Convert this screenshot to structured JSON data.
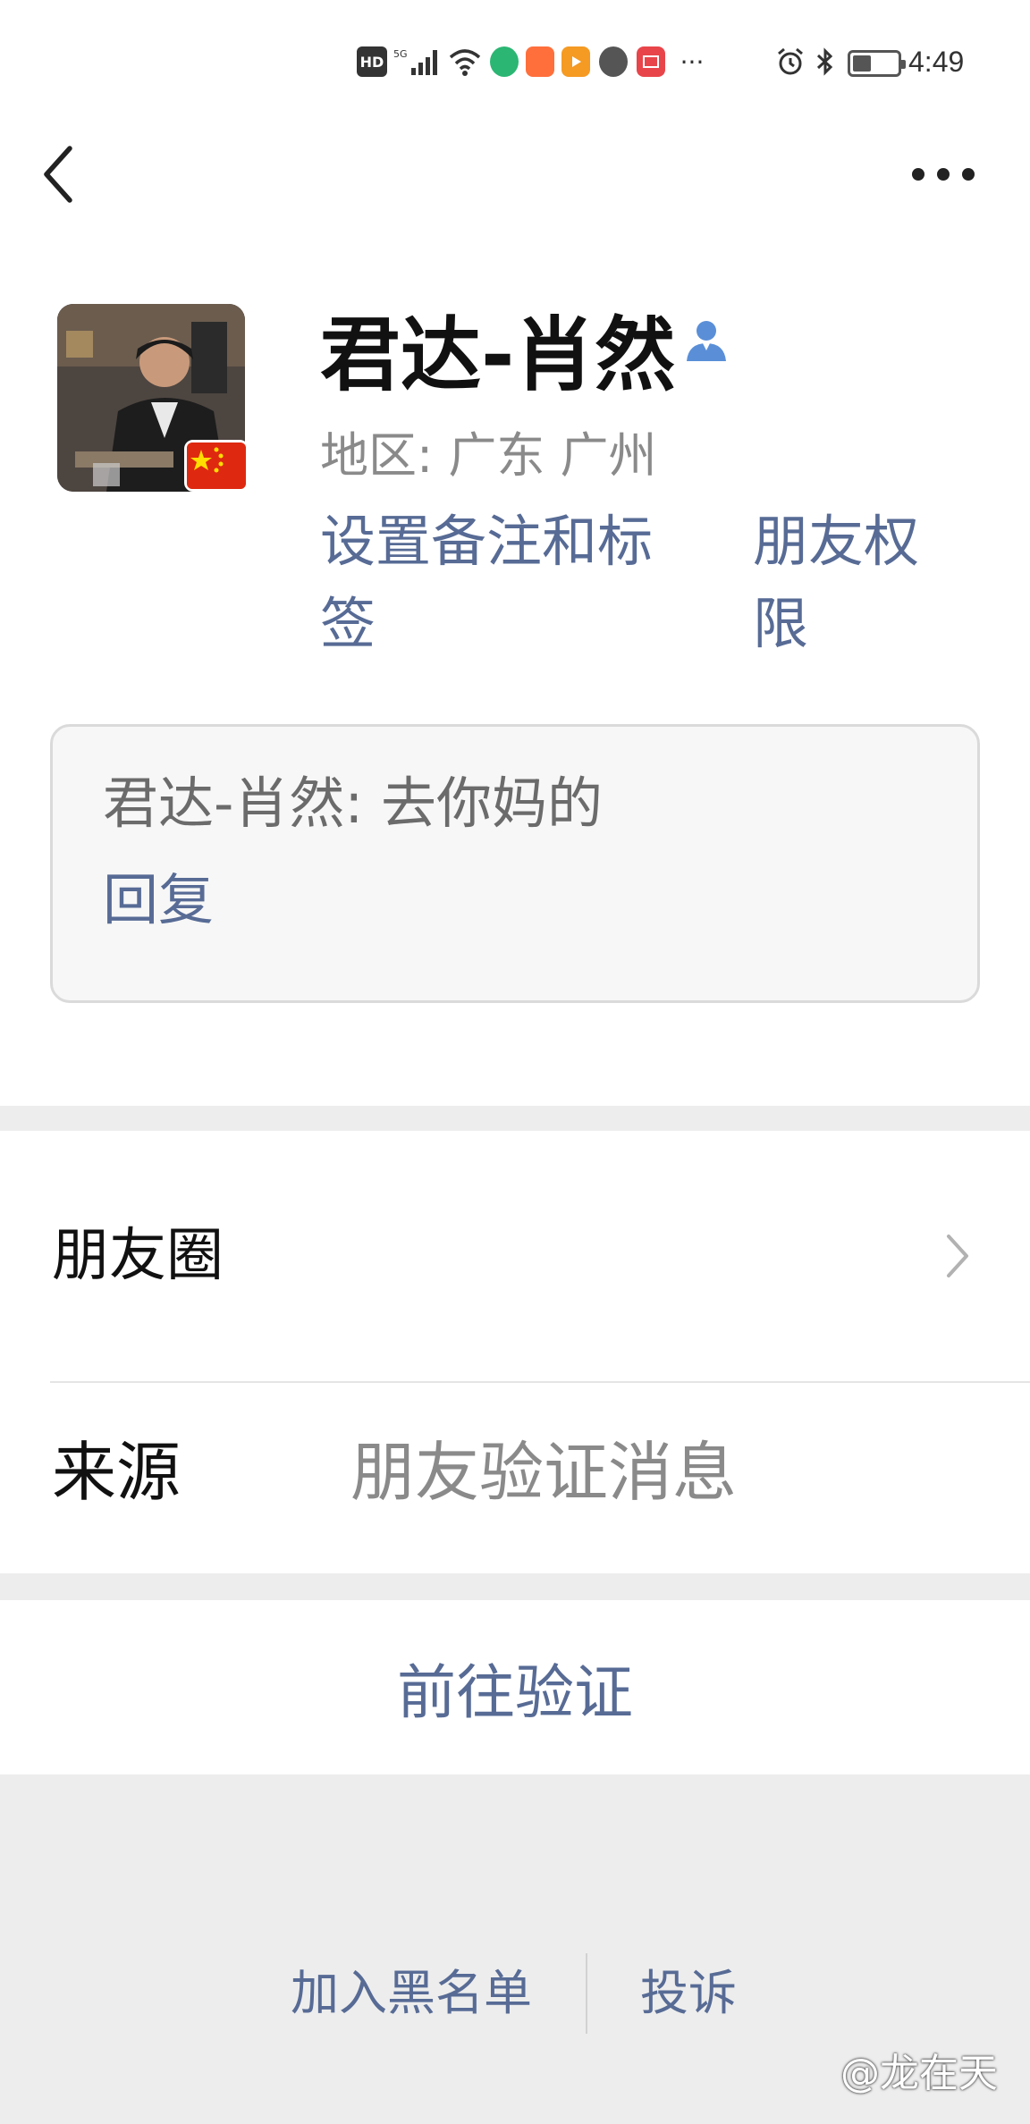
{
  "status_bar": {
    "hd_label": "HD",
    "signal_label": "5G",
    "time": "4:49",
    "more_label": "···",
    "app_icon_colors": [
      "#2bb673",
      "#ff6f3c",
      "#f59a23",
      "#555555",
      "#e8454a"
    ]
  },
  "nav": {
    "back_icon": "back-arrow-icon",
    "more_icon": "more-dots-icon"
  },
  "profile": {
    "name": "君达-肖然",
    "region": "地区:  广东  广州",
    "set_remark_label": "设置备注和标签",
    "friend_permission_label": "朋友权限",
    "message_text": "君达-肖然: 去你妈的",
    "reply_label": "回复"
  },
  "info": {
    "moments_label": "朋友圈",
    "source_label": "来源",
    "source_value": "朋友验证消息"
  },
  "actions": {
    "verify_label": "前往验证",
    "blacklist_label": "加入黑名单",
    "report_label": "投诉"
  },
  "watermark": "@龙在天",
  "colors": {
    "link": "#576b95",
    "background": "#ededed",
    "card": "#ffffff"
  }
}
